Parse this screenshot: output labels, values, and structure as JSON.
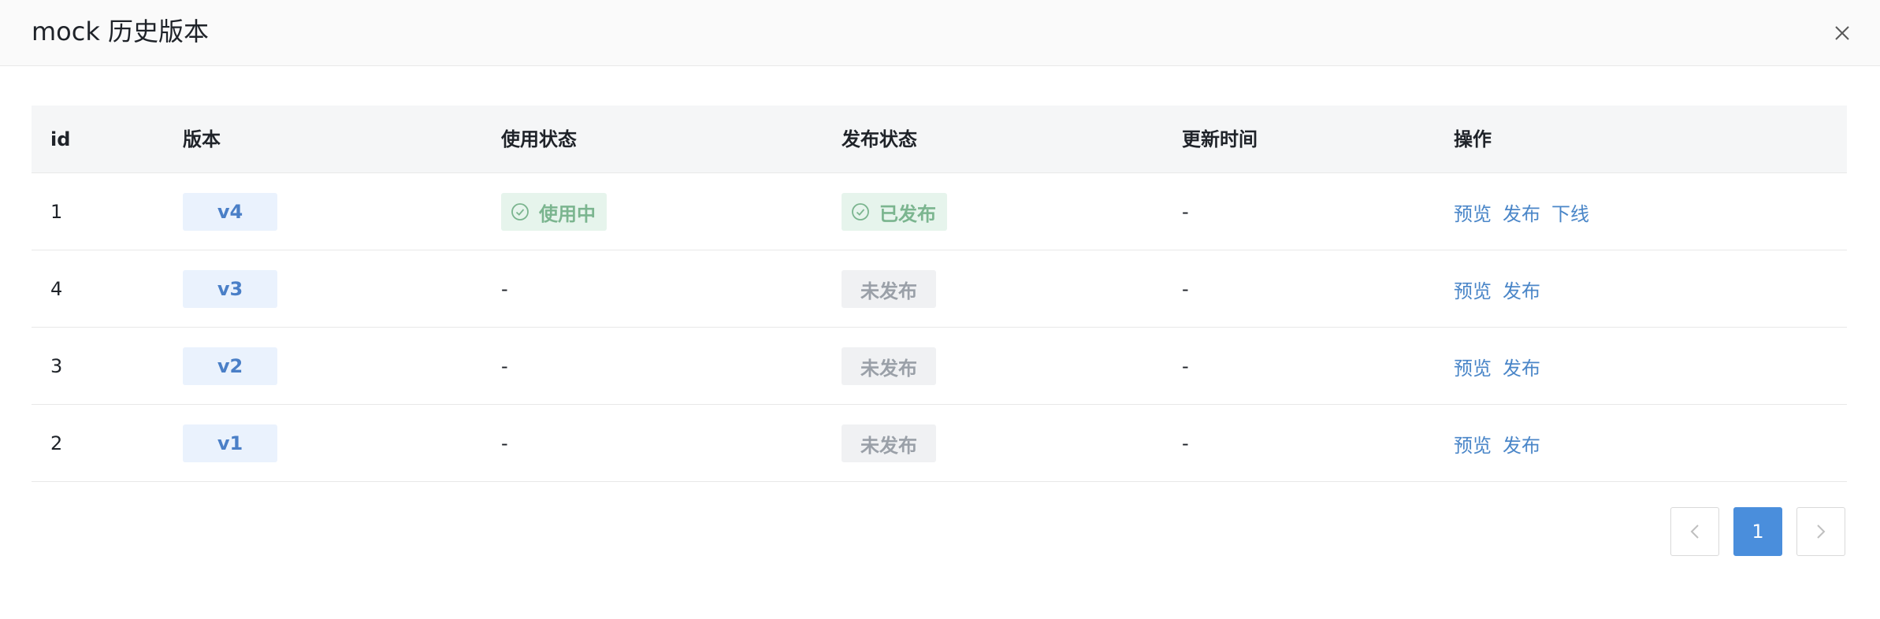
{
  "modal": {
    "title": "mock 历史版本"
  },
  "table": {
    "headers": {
      "id": "id",
      "version": "版本",
      "use_status": "使用状态",
      "publish_status": "发布状态",
      "update_time": "更新时间",
      "actions": "操作"
    },
    "rows": [
      {
        "id": "1",
        "version": "v4",
        "use_status": "使用中",
        "publish_status": "已发布",
        "update_time": "-",
        "actions": [
          "预览",
          "发布",
          "下线"
        ]
      },
      {
        "id": "4",
        "version": "v3",
        "use_status": "-",
        "publish_status": "未发布",
        "update_time": "-",
        "actions": [
          "预览",
          "发布"
        ]
      },
      {
        "id": "3",
        "version": "v2",
        "use_status": "-",
        "publish_status": "未发布",
        "update_time": "-",
        "actions": [
          "预览",
          "发布"
        ]
      },
      {
        "id": "2",
        "version": "v1",
        "use_status": "-",
        "publish_status": "未发布",
        "update_time": "-",
        "actions": [
          "预览",
          "发布"
        ]
      }
    ]
  },
  "pagination": {
    "current_page": "1",
    "prev_icon": "chevron-left-icon",
    "next_icon": "chevron-right-icon"
  },
  "colors": {
    "link": "#4a86c8",
    "success": "#7bb58f",
    "active_page": "#4a8edc"
  }
}
